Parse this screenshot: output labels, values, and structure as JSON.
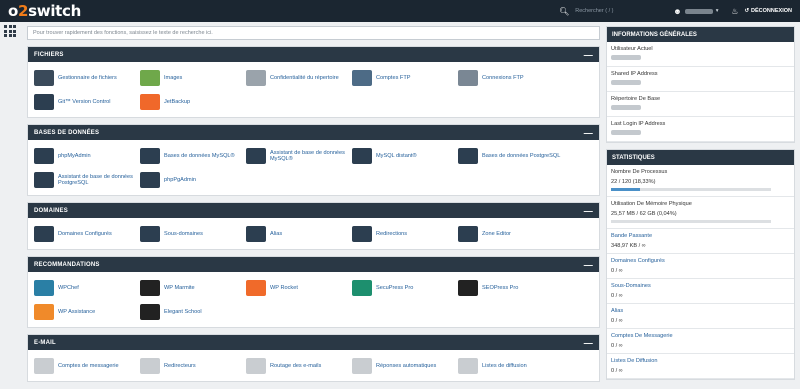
{
  "brand": {
    "logo_a": "o",
    "logo_b": "2",
    "logo_c": "switch"
  },
  "topbar": {
    "search_placeholder": "Rechercher ( / )",
    "logout": "DÉCONNEXION"
  },
  "search": {
    "placeholder": "Pour trouver rapidement des fonctions, saisissez le texte de recherche ici."
  },
  "sections": [
    {
      "title": "FICHIERS",
      "items": [
        {
          "label": "Gestionnaire de fichiers",
          "icon": "file-manager-icon",
          "color": "#3a4a5a"
        },
        {
          "label": "Images",
          "icon": "images-icon",
          "color": "#6fa84a"
        },
        {
          "label": "Confidentialité du répertoire",
          "icon": "folder-privacy-icon",
          "color": "#9aa3ab"
        },
        {
          "label": "Comptes FTP",
          "icon": "ftp-accounts-icon",
          "color": "#4d6b86"
        },
        {
          "label": "Connexions FTP",
          "icon": "ftp-connections-icon",
          "color": "#7a8794"
        },
        {
          "label": "Git™ Version Control",
          "icon": "git-icon",
          "color": "#2c3e50"
        },
        {
          "label": "JetBackup",
          "icon": "jetbackup-icon",
          "color": "#f0682a"
        }
      ]
    },
    {
      "title": "BASES DE DONNÉES",
      "items": [
        {
          "label": "phpMyAdmin",
          "icon": "phpmyadmin-icon",
          "color": "#2c3e50"
        },
        {
          "label": "Bases de données MySQL®",
          "icon": "mysql-databases-icon",
          "color": "#2c3e50"
        },
        {
          "label": "Assistant de base de données MySQL®",
          "icon": "mysql-wizard-icon",
          "color": "#2c3e50"
        },
        {
          "label": "MySQL distant®",
          "icon": "remote-mysql-icon",
          "color": "#2c3e50"
        },
        {
          "label": "Bases de données PostgreSQL",
          "icon": "postgresql-databases-icon",
          "color": "#2c3e50"
        },
        {
          "label": "Assistant de base de données PostgreSQL",
          "icon": "postgresql-wizard-icon",
          "color": "#2c3e50"
        },
        {
          "label": "phpPgAdmin",
          "icon": "phppgadmin-icon",
          "color": "#2c3e50"
        }
      ]
    },
    {
      "title": "DOMAINES",
      "items": [
        {
          "label": "Domaines Configurés",
          "icon": "domains-icon",
          "color": "#2c3e50"
        },
        {
          "label": "Sous-domaines",
          "icon": "subdomains-icon",
          "color": "#2c3e50"
        },
        {
          "label": "Alias",
          "icon": "aliases-icon",
          "color": "#2c3e50"
        },
        {
          "label": "Redirections",
          "icon": "redirects-icon",
          "color": "#2c3e50"
        },
        {
          "label": "Zone Editor",
          "icon": "zone-editor-icon",
          "color": "#2c3e50"
        }
      ]
    },
    {
      "title": "RECOMMANDATIONS",
      "items": [
        {
          "label": "WPChef",
          "icon": "wpchef-icon",
          "color": "#2a7fa5"
        },
        {
          "label": "WP Marmite",
          "icon": "wp-marmite-icon",
          "color": "#222"
        },
        {
          "label": "WP Rocket",
          "icon": "wp-rocket-icon",
          "color": "#f06a2a"
        },
        {
          "label": "SecuPress Pro",
          "icon": "secupress-icon",
          "color": "#1d8f6e"
        },
        {
          "label": "SEOPress Pro",
          "icon": "seopress-icon",
          "color": "#222"
        },
        {
          "label": "WP Assistance",
          "icon": "wp-assistance-icon",
          "color": "#f08a2a"
        },
        {
          "label": "Elegant School",
          "icon": "elegant-school-icon",
          "color": "#222"
        }
      ]
    },
    {
      "title": "E-MAIL",
      "items": [
        {
          "label": "Comptes de messagerie",
          "icon": "email-accounts-icon",
          "color": "#c9cdd1"
        },
        {
          "label": "Redirecteurs",
          "icon": "forwarders-icon",
          "color": "#c9cdd1"
        },
        {
          "label": "Routage des e-mails",
          "icon": "email-routing-icon",
          "color": "#c9cdd1"
        },
        {
          "label": "Réponses automatiques",
          "icon": "autoresponders-icon",
          "color": "#c9cdd1"
        },
        {
          "label": "Listes de diffusion",
          "icon": "mailing-lists-icon",
          "color": "#c9cdd1"
        }
      ]
    }
  ],
  "info": {
    "title": "INFORMATIONS GÉNÉRALES",
    "rows": [
      "Utilisateur Actuel",
      "Shared IP Address",
      "Répertoire De Base",
      "Last Login IP Address"
    ]
  },
  "stats": {
    "title": "STATISTIQUES",
    "rows": [
      {
        "label": "Nombre De Processus",
        "value": "22 / 120   (18,33%)",
        "link": false,
        "bar": true,
        "fill": 0.1833
      },
      {
        "label": "Utilisation De Mémoire Physique",
        "value": "25,57 MB / 62 GB   (0,04%)",
        "link": false,
        "bar": true,
        "fill": 0.0004
      },
      {
        "label": "Bande Passante",
        "value": "348,97 KB / ∞",
        "link": true,
        "bar": false
      },
      {
        "label": "Domaines Configurés",
        "value": "0 / ∞",
        "link": true,
        "bar": false
      },
      {
        "label": "Sous-Domaines",
        "value": "0 / ∞",
        "link": true,
        "bar": false
      },
      {
        "label": "Alias",
        "value": "0 / ∞",
        "link": true,
        "bar": false
      },
      {
        "label": "Comptes De Messagerie",
        "value": "0 / ∞",
        "link": true,
        "bar": false
      },
      {
        "label": "Listes De Diffusion",
        "value": "0 / ∞",
        "link": true,
        "bar": false
      }
    ]
  },
  "collapse_glyph": "—",
  "user_icon": "user-icon",
  "bell_icon": "bell-icon"
}
